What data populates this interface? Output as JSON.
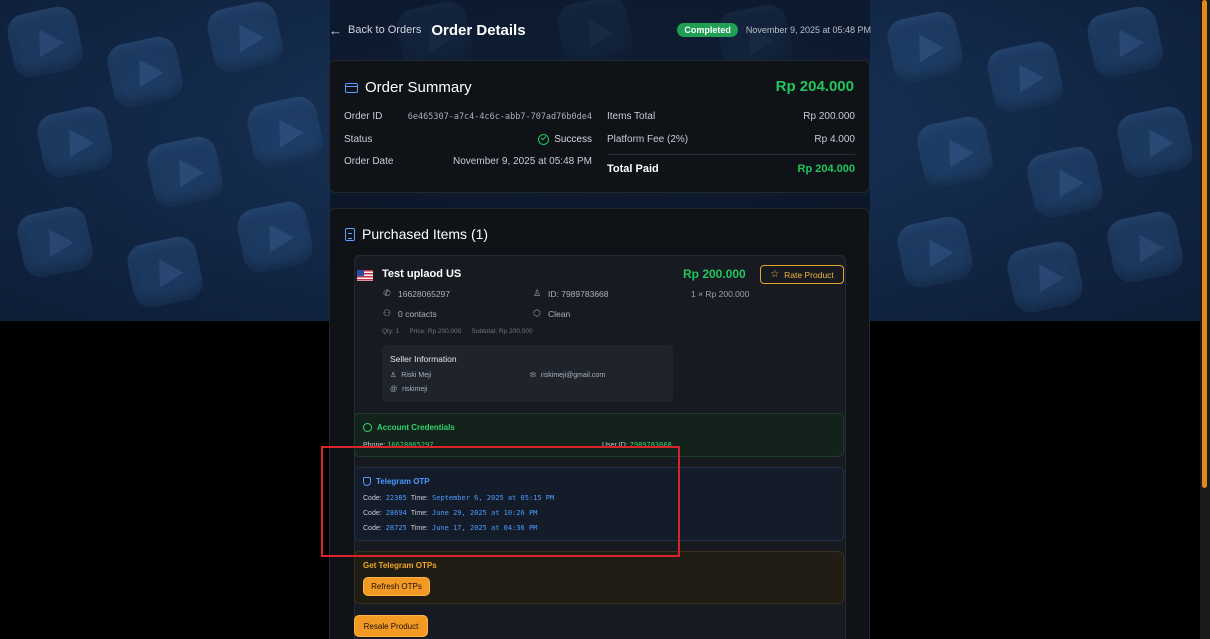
{
  "header": {
    "back_label": "Back to Orders",
    "title": "Order Details",
    "status_badge": "Completed",
    "date": "November 9, 2025 at 05:48 PM"
  },
  "summary": {
    "title": "Order Summary",
    "total": "Rp 204.000",
    "left": {
      "order_id_label": "Order ID",
      "order_id": "6e465307-a7c4-4c6c-abb7-707ad76b0de4",
      "status_label": "Status",
      "status": "Success",
      "date_label": "Order Date",
      "date": "November 9, 2025 at 05:48 PM"
    },
    "right": {
      "items_total_label": "Items Total",
      "items_total": "Rp 200.000",
      "fee_label": "Platform Fee (2%)",
      "fee": "Rp 4.000",
      "total_paid_label": "Total Paid",
      "total_paid": "Rp 204.000"
    }
  },
  "items": {
    "title": "Purchased Items (1)",
    "product": {
      "name": "Test uplaod US",
      "price": "Rp 200.000",
      "rate_label": "Rate Product",
      "qty_line": "1 × Rp 200.000",
      "phone": "16628065297",
      "id": "ID: 7989783668",
      "contacts": "0 contacts",
      "clean": "Clean",
      "qty": "Qty: 1",
      "unit_price": "Price: Rp 200.000",
      "subtotal": "Subtotal: Rp 200.000"
    },
    "seller": {
      "title": "Seller Information",
      "name": "Riski Meji",
      "email": "riskimeji@gmail.com",
      "username": "riskimeji"
    },
    "credentials": {
      "title": "Account Credentials",
      "phone_label": "Phone:",
      "phone": "16628065297",
      "user_id_label": "User ID:",
      "user_id": "7989783668"
    },
    "otp": {
      "title": "Telegram OTP",
      "code_label": "Code:",
      "time_label": "Time:",
      "entries": [
        {
          "code": "22385",
          "time": "September 6, 2025 at 05:15 PM"
        },
        {
          "code": "28694",
          "time": "June 29, 2025 at 10:26 PM"
        },
        {
          "code": "28725",
          "time": "June 17, 2025 at 04:36 PM"
        }
      ]
    },
    "get_otp": {
      "title": "Get Telegram OTPs",
      "refresh_label": "Refresh OTPs"
    },
    "resale_label": "Resale Product"
  },
  "colors": {
    "accent_green": "#22c55e",
    "accent_blue": "#4b9bff",
    "accent_orange": "#f39a25",
    "highlight_red": "#d9242b"
  }
}
